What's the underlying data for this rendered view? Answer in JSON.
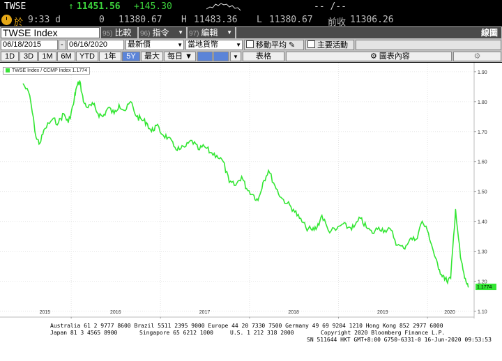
{
  "header": {
    "ticker": "TWSE",
    "arrow": "↑",
    "price": "11451.56",
    "change": "+145.30",
    "bid_ask": "-- /--",
    "clock_icon": "clock-icon",
    "row2": {
      "label_char": "於",
      "time": "9:33 d",
      "zero": "0",
      "open": "11380.67",
      "h_label": "H",
      "high": "11483.36",
      "l_label": "L",
      "low": "11380.67",
      "prev_label": "前收",
      "prev_close": "11306.26"
    }
  },
  "toolbar": {
    "security": "TWSE Index",
    "btn95_num": "95)",
    "btn95": "比較",
    "btn96_num": "96)",
    "btn96": "指令",
    "btn97_num": "97)",
    "btn97": "編輯",
    "right_label": "線圖"
  },
  "controls": {
    "date_from": "06/18/2015",
    "dash": "-",
    "date_to": "06/16/2020",
    "price_field": "最新價",
    "currency": "當地貨幣",
    "moving_avg": "移動平均",
    "key_events": "主要活動",
    "table": "表格",
    "chart_content": "圖表內容"
  },
  "periods": {
    "items": [
      "1D",
      "3D",
      "1M",
      "6M",
      "YTD",
      "1年",
      "5Y",
      "最大",
      "每日 ▼"
    ],
    "active": "5Y"
  },
  "chart_data": {
    "type": "line",
    "legend": "TWSE Index / CCMP Index  1.1774",
    "last_value_label": "1.1774",
    "series_color": "#33e633",
    "ylim": [
      1.08,
      1.93
    ],
    "yticks": [
      "1.90",
      "1.80",
      "1.70",
      "1.60",
      "1.50",
      "1.40",
      "1.30",
      "1.20",
      "1.10"
    ],
    "xticks": [
      "2015",
      "2016",
      "2017",
      "2018",
      "2019",
      "2020"
    ],
    "x": [
      "2015-06-18",
      "2015-07-15",
      "2015-08-10",
      "2015-08-25",
      "2015-09-15",
      "2015-10-15",
      "2015-11-10",
      "2015-12-01",
      "2015-12-20",
      "2016-01-10",
      "2016-01-20",
      "2016-02-05",
      "2016-02-20",
      "2016-03-10",
      "2016-04-01",
      "2016-04-20",
      "2016-05-10",
      "2016-06-01",
      "2016-06-25",
      "2016-07-15",
      "2016-08-10",
      "2016-09-01",
      "2016-09-25",
      "2016-10-15",
      "2016-11-05",
      "2016-11-25",
      "2016-12-15",
      "2017-01-10",
      "2017-02-01",
      "2017-02-25",
      "2017-03-20",
      "2017-04-15",
      "2017-05-10",
      "2017-06-05",
      "2017-06-30",
      "2017-07-25",
      "2017-08-20",
      "2017-09-15",
      "2017-10-10",
      "2017-11-05",
      "2017-11-30",
      "2017-12-20",
      "2018-01-15",
      "2018-02-05",
      "2018-02-25",
      "2018-03-20",
      "2018-04-15",
      "2018-05-10",
      "2018-06-05",
      "2018-06-30",
      "2018-07-25",
      "2018-08-20",
      "2018-09-15",
      "2018-10-05",
      "2018-10-25",
      "2018-11-20",
      "2018-12-20",
      "2019-01-15",
      "2019-02-10",
      "2019-03-05",
      "2019-04-01",
      "2019-04-25",
      "2019-05-20",
      "2019-06-15",
      "2019-07-10",
      "2019-08-05",
      "2019-08-30",
      "2019-09-25",
      "2019-10-20",
      "2019-11-15",
      "2019-12-10",
      "2020-01-05",
      "2020-01-25",
      "2020-02-15",
      "2020-03-05",
      "2020-03-20",
      "2020-04-05",
      "2020-04-25",
      "2020-05-15",
      "2020-06-01",
      "2020-06-16"
    ],
    "values": [
      1.86,
      1.82,
      1.68,
      1.66,
      1.71,
      1.74,
      1.73,
      1.76,
      1.73,
      1.79,
      1.84,
      1.87,
      1.8,
      1.78,
      1.79,
      1.76,
      1.75,
      1.78,
      1.76,
      1.79,
      1.77,
      1.8,
      1.75,
      1.74,
      1.73,
      1.7,
      1.72,
      1.69,
      1.68,
      1.65,
      1.64,
      1.65,
      1.67,
      1.64,
      1.65,
      1.63,
      1.62,
      1.6,
      1.53,
      1.52,
      1.55,
      1.51,
      1.49,
      1.47,
      1.53,
      1.57,
      1.52,
      1.48,
      1.46,
      1.44,
      1.41,
      1.38,
      1.37,
      1.38,
      1.42,
      1.37,
      1.37,
      1.39,
      1.38,
      1.38,
      1.41,
      1.38,
      1.36,
      1.38,
      1.37,
      1.37,
      1.32,
      1.31,
      1.34,
      1.34,
      1.4,
      1.36,
      1.3,
      1.24,
      1.22,
      1.2,
      1.21,
      1.44,
      1.28,
      1.21,
      1.18
    ]
  },
  "footer": {
    "line1": "Australia 61 2 9777 8600 Brazil 5511 2395 9000 Europe 44 20 7330 7500 Germany 49 69 9204 1210 Hong Kong 852 2977 6000",
    "line2a": "Japan 81 3 4565 8900",
    "line2b": "Singapore 65 6212 1000",
    "line2c": "U.S. 1 212 318 2000",
    "line2d": "Copyright 2020 Bloomberg Finance L.P.",
    "line3": "SN 511644 HKT  GMT+8:00 G750-6331-0 16-Jun-2020 09:53:53"
  }
}
